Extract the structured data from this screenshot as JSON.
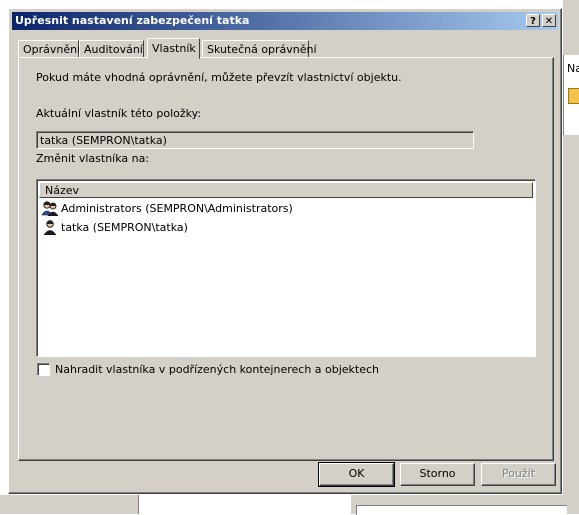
{
  "window": {
    "title": "Upřesnit nastavení zabezpečení tatka",
    "help_label": "?",
    "close_label": "✕"
  },
  "tabs": [
    {
      "label": "Oprávnění",
      "active": false
    },
    {
      "label": "Auditování",
      "active": false
    },
    {
      "label": "Vlastník",
      "active": true
    },
    {
      "label": "Skutečná oprávnění",
      "active": false
    }
  ],
  "owner_tab": {
    "info_text": "Pokud máte vhodná oprávnění, můžete převzít vlastnictví objektu.",
    "current_owner_label": "Aktuální vlastník této položky:",
    "current_owner_value": "tatka (SEMPRON\\tatka)",
    "change_owner_label": "Změnit vlastníka na:",
    "list_column_name": "Název",
    "owners": [
      {
        "name": "Administrators (SEMPRON\\Administrators)",
        "icon": "user-group-icon"
      },
      {
        "name": "tatka (SEMPRON\\tatka)",
        "icon": "user-icon"
      }
    ],
    "replace_owner_checkbox_label": "Nahradit vlastníka v podřízených kontejnerech a objektech",
    "replace_owner_checked": false
  },
  "buttons": {
    "ok": "OK",
    "cancel": "Storno",
    "apply": "Použít"
  },
  "background": {
    "partial_text": "Na"
  }
}
